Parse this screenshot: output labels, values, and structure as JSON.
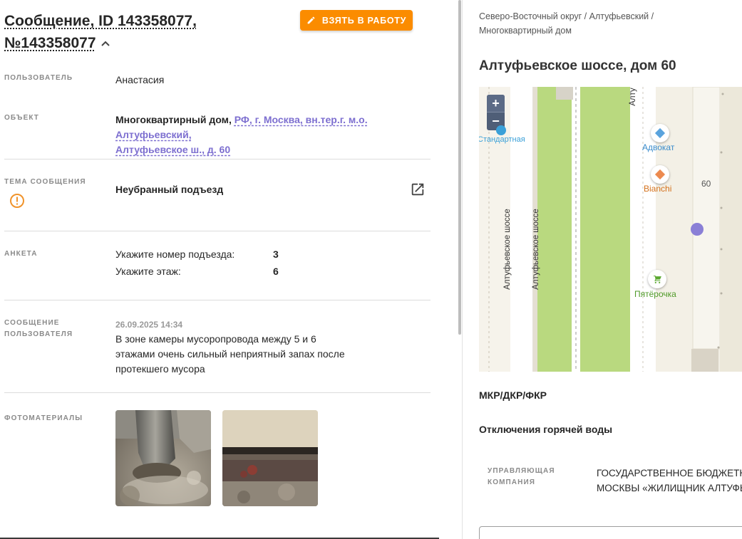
{
  "header": {
    "title_line1": "Сообщение, ID 143358077,",
    "title_line2": "№143358077",
    "take_button": "ВЗЯТЬ В РАБОТУ"
  },
  "fields": {
    "user": {
      "label": "ПОЛЬЗОВАТЕЛЬ",
      "value": "Анастасия"
    },
    "object": {
      "label": "ОБЪЕКТ",
      "type": "Многоквартирный дом,",
      "address_link_1": "РФ, г. Москва, вн.тер.г. м.о. Алтуфьевский,",
      "address_link_2": "Алтуфьевское ш., д. 60"
    },
    "topic": {
      "label": "ТЕМА СООБЩЕНИЯ",
      "value": "Неубранный подъезд"
    },
    "survey": {
      "label": "АНКЕТА",
      "rows": [
        {
          "q": "Укажите номер подъезда:",
          "a": "3"
        },
        {
          "q": "Укажите этаж:",
          "a": "6"
        }
      ]
    },
    "message": {
      "label_1": "СООБЩЕНИЕ",
      "label_2": "ПОЛЬЗОВАТЕЛЯ",
      "date": "26.09.2025 14:34",
      "text_1": "В зоне камеры мусоропровода между 5 и 6",
      "text_2": "этажами очень сильный неприятный запах после",
      "text_3": "протекшего мусора"
    },
    "photos": {
      "label": "ФОТОМАТЕРИАЛЫ",
      "count": 2
    }
  },
  "right": {
    "breadcrumb_1": "Северо-Восточный округ / Алтуфьевский /",
    "breadcrumb_2": "Многоквартирный дом",
    "address": "Алтуфьевское шоссе, дом 60",
    "map": {
      "zoom_in": "+",
      "zoom_out": "−",
      "stop_label": "Стандартная",
      "road_label": "Алтуфьевское шоссе",
      "road_label_top": "Алту",
      "house_number": "60",
      "poi_1": "Адвокат",
      "poi_2": "Bianchi",
      "poi_3": "Пятёрочка"
    },
    "section_mkr": "МКР/ДКР/ФКР",
    "section_hot": "Отключения горячей воды",
    "uk_label_1": "УПРАВЛЯЮЩАЯ",
    "uk_label_2": "КОМПАНИЯ",
    "uk_value_1": "ГОСУДАРСТВЕННОЕ БЮДЖЕТНОЕ",
    "uk_value_2": "МОСКВЫ «ЖИЛИЩНИК АЛТУФЬЕВСКИЙ»"
  },
  "colors": {
    "accent_orange": "#fb8c00",
    "link_purple": "#7d6fd0",
    "warn_orange": "#f0932b",
    "map_green": "#b9d97f",
    "map_marker": "#8a7fd6"
  }
}
